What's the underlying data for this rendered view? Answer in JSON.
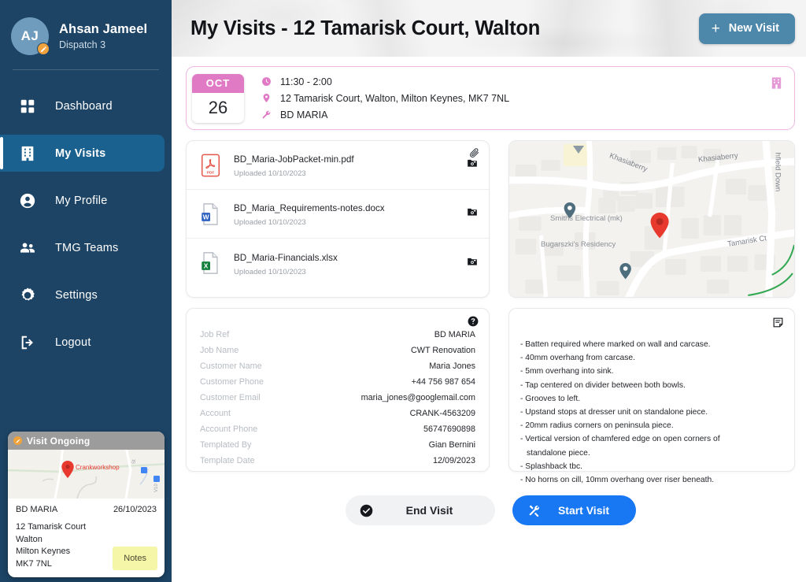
{
  "sidebar": {
    "profile": {
      "initials": "AJ",
      "name": "Ahsan Jameel",
      "role": "Dispatch 3",
      "badge_icon": "pencil-icon"
    },
    "items": [
      {
        "label": "Dashboard",
        "icon": "grid-icon",
        "active": false
      },
      {
        "label": "My Visits",
        "icon": "building-icon",
        "active": true
      },
      {
        "label": "My Profile",
        "icon": "user-icon",
        "active": false
      },
      {
        "label": "TMG Teams",
        "icon": "people-icon",
        "active": false
      },
      {
        "label": "Settings",
        "icon": "gear-icon",
        "active": false
      },
      {
        "label": "Logout",
        "icon": "logout-icon",
        "active": false
      }
    ],
    "ongoing": {
      "title": "Visit Ongoing",
      "status_icon": "pencil-icon",
      "map_label": "Crankworkshop",
      "job_ref": "BD MARIA",
      "date": "26/10/2023",
      "address_lines": [
        "12 Tamarisk Court",
        "Walton",
        "Milton Keynes",
        "MK7 7NL"
      ],
      "notes_label": "Notes"
    }
  },
  "header": {
    "title": "My Visits - 12 Tamarisk Court, Walton",
    "new_visit_label": "New Visit",
    "new_visit_icon": "plus-icon",
    "new_visit_color": "#4d87aa"
  },
  "visit_banner": {
    "month": "OCT",
    "day": "26",
    "accent_color": "#e07ac4",
    "border_color": "#f0b7e2",
    "time": "11:30 - 2:00",
    "time_icon": "clock-icon",
    "address": "12 Tamarisk Court, Walton, Milton Keynes, MK7 7NL",
    "address_icon": "location-pin-icon",
    "job_ref": "BD MARIA",
    "job_icon": "wrench-icon",
    "corner_icon": "building-icon"
  },
  "files": {
    "attach_icon": "paperclip-icon",
    "items": [
      {
        "name": "BD_Maria-JobPacket-min.pdf",
        "uploaded": "Uploaded 10/10/2023",
        "type": "pdf",
        "action_icon": "download-folder-icon"
      },
      {
        "name": "BD_Maria_Requirements-notes.docx",
        "uploaded": "Uploaded 10/10/2023",
        "type": "docx",
        "action_icon": "download-folder-icon"
      },
      {
        "name": "BD_Maria-Financials.xlsx",
        "uploaded": "Uploaded 10/10/2023",
        "type": "xlsx",
        "action_icon": "download-folder-icon"
      }
    ]
  },
  "map": {
    "place_labels": [
      "Smiths Electrical (mk)",
      "Bugarszki's Residency"
    ],
    "road_labels": [
      "Khasiaberry",
      "Khasiaberry",
      "hfield Down",
      "Tamarisk Ct"
    ],
    "marker_color": "#e8392f",
    "poi_color": "#4e6e7e"
  },
  "details": {
    "help_icon": "help-circle-icon",
    "rows": [
      {
        "key": "Job Ref",
        "value": "BD MARIA"
      },
      {
        "key": "Job Name",
        "value": "CWT Renovation"
      },
      {
        "key": "Customer Name",
        "value": "Maria Jones"
      },
      {
        "key": "Customer Phone",
        "value": "+44 756 987 654"
      },
      {
        "key": "Customer Email",
        "value": "maria_jones@googlemail.com"
      },
      {
        "key": "Account",
        "value": "CRANK-4563209"
      },
      {
        "key": "Account Phone",
        "value": "56747690898"
      },
      {
        "key": "Templated By",
        "value": "Gian Bernini"
      },
      {
        "key": "Template Date",
        "value": "12/09/2023"
      }
    ]
  },
  "notes": {
    "icon": "note-icon",
    "lines": [
      {
        "text": "- Batten required where marked on wall and carcase.",
        "continuation": false
      },
      {
        "text": "- 40mm overhang from carcase.",
        "continuation": false
      },
      {
        "text": "- 5mm overhang into sink.",
        "continuation": false
      },
      {
        "text": "- Tap centered on divider between both bowls.",
        "continuation": false
      },
      {
        "text": "- Grooves to left.",
        "continuation": false
      },
      {
        "text": "- Upstand stops at dresser unit on standalone piece.",
        "continuation": false
      },
      {
        "text": "- 20mm radius corners on peninsula piece.",
        "continuation": false
      },
      {
        "text": "- Vertical version of chamfered edge on open corners of",
        "continuation": false
      },
      {
        "text": "standalone piece.",
        "continuation": true
      },
      {
        "text": "- Splashback tbc.",
        "continuation": false
      },
      {
        "text": "- No horns on cill, 10mm overhang over riser beneath.",
        "continuation": false
      }
    ]
  },
  "actions": {
    "end_visit": {
      "label": "End Visit",
      "icon": "check-circle-icon",
      "color": "#f1f2f4"
    },
    "start_visit": {
      "label": "Start Visit",
      "icon": "tools-icon",
      "color": "#1877f2"
    }
  }
}
